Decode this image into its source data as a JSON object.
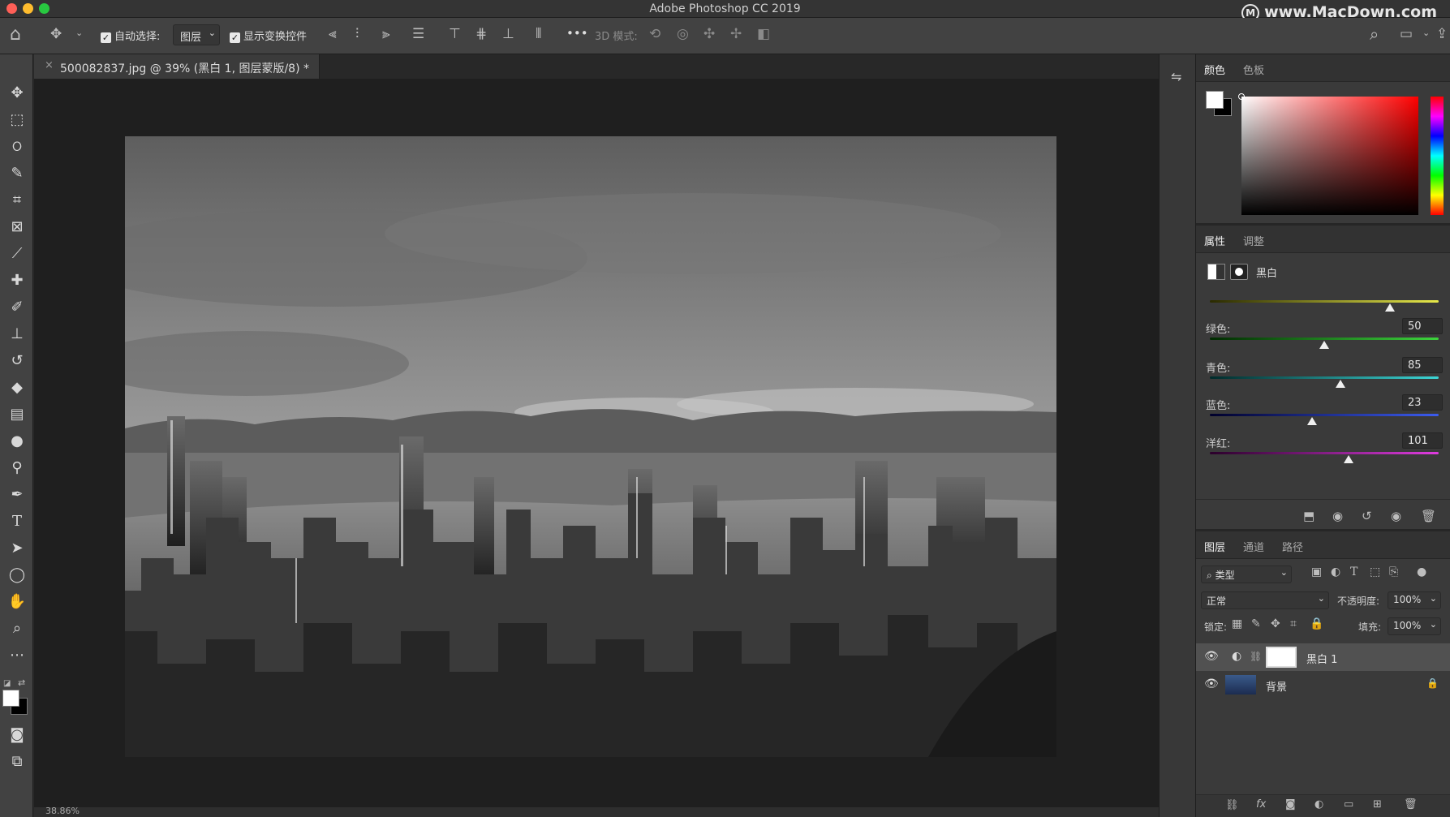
{
  "window": {
    "title": "Adobe Photoshop CC 2019",
    "watermark": "www.MacDown.com"
  },
  "options_bar": {
    "auto_select_label": "自动选择:",
    "auto_select_target": "图层",
    "show_transform_label": "显示变换控件",
    "mode_3d_label": "3D 模式:",
    "more_label": "•••"
  },
  "document": {
    "tab_title": "500082837.jpg @ 39% (黑白 1, 图层蒙版/8) *",
    "close_glyph": "×",
    "image_desc_icon": "hong-kong-skyline-grayscale-photo"
  },
  "color_panel": {
    "tabs": [
      "颜色",
      "色板"
    ],
    "active_tab": 0,
    "foreground": "#ffffff",
    "background": "#000000"
  },
  "properties_panel": {
    "tabs": [
      "属性",
      "调整"
    ],
    "active_tab": 0,
    "adjustment_name": "黑白",
    "sliders": [
      {
        "label": "",
        "value": "",
        "position": 0.77
      },
      {
        "label": "绿色:",
        "value": "50",
        "position": 0.49
      },
      {
        "label": "青色:",
        "value": "85",
        "position": 0.57
      },
      {
        "label": "蓝色:",
        "value": "23",
        "position": 0.42
      },
      {
        "label": "洋红:",
        "value": "101",
        "position": 0.6
      }
    ]
  },
  "layers_panel": {
    "tabs": [
      "图层",
      "通道",
      "路径"
    ],
    "active_tab": 0,
    "filter_label": "类型",
    "blend_mode": "正常",
    "opacity_label": "不透明度:",
    "opacity_value": "100%",
    "lock_label": "锁定:",
    "fill_label": "填充:",
    "fill_value": "100%",
    "layers": [
      {
        "name": "黑白 1",
        "selected": true
      },
      {
        "name": "背景",
        "selected": false
      }
    ]
  },
  "status_bar": {
    "zoom": "38.86%"
  }
}
